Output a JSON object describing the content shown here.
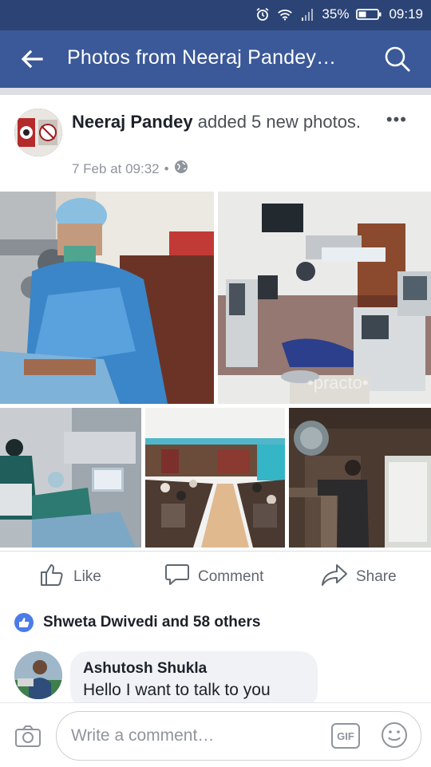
{
  "status_bar": {
    "alarm_icon": "alarm-icon",
    "wifi_icon": "wifi-icon",
    "signal_icon": "signal-icon",
    "battery_percent": "35%",
    "battery_icon": "battery-icon",
    "time": "09:19"
  },
  "app_bar": {
    "title": "Photos from Neeraj Pandey…",
    "back_icon": "arrow-left-icon",
    "search_icon": "search-icon",
    "color": "#3b5998"
  },
  "post": {
    "author": "Neeraj Pandey",
    "action_text": "added 5 new photos.",
    "date": "7 Feb at 09:32",
    "separator": "•",
    "privacy_icon": "globe-icon",
    "more_icon": "more-icon",
    "more_glyph": "•••",
    "watermark": "•practo•"
  },
  "actions": {
    "like": "Like",
    "comment": "Comment",
    "share": "Share"
  },
  "reactions": {
    "text": "Shweta Dwivedi and 58 others",
    "accent": "#4c7ce8"
  },
  "comment": {
    "name": "Ashutosh Shukla",
    "text": "Hello I want to talk to you"
  },
  "composer": {
    "placeholder": "Write a comment…",
    "camera_icon": "camera-icon",
    "gif_label": "GIF",
    "emoji_icon": "emoji-icon"
  }
}
